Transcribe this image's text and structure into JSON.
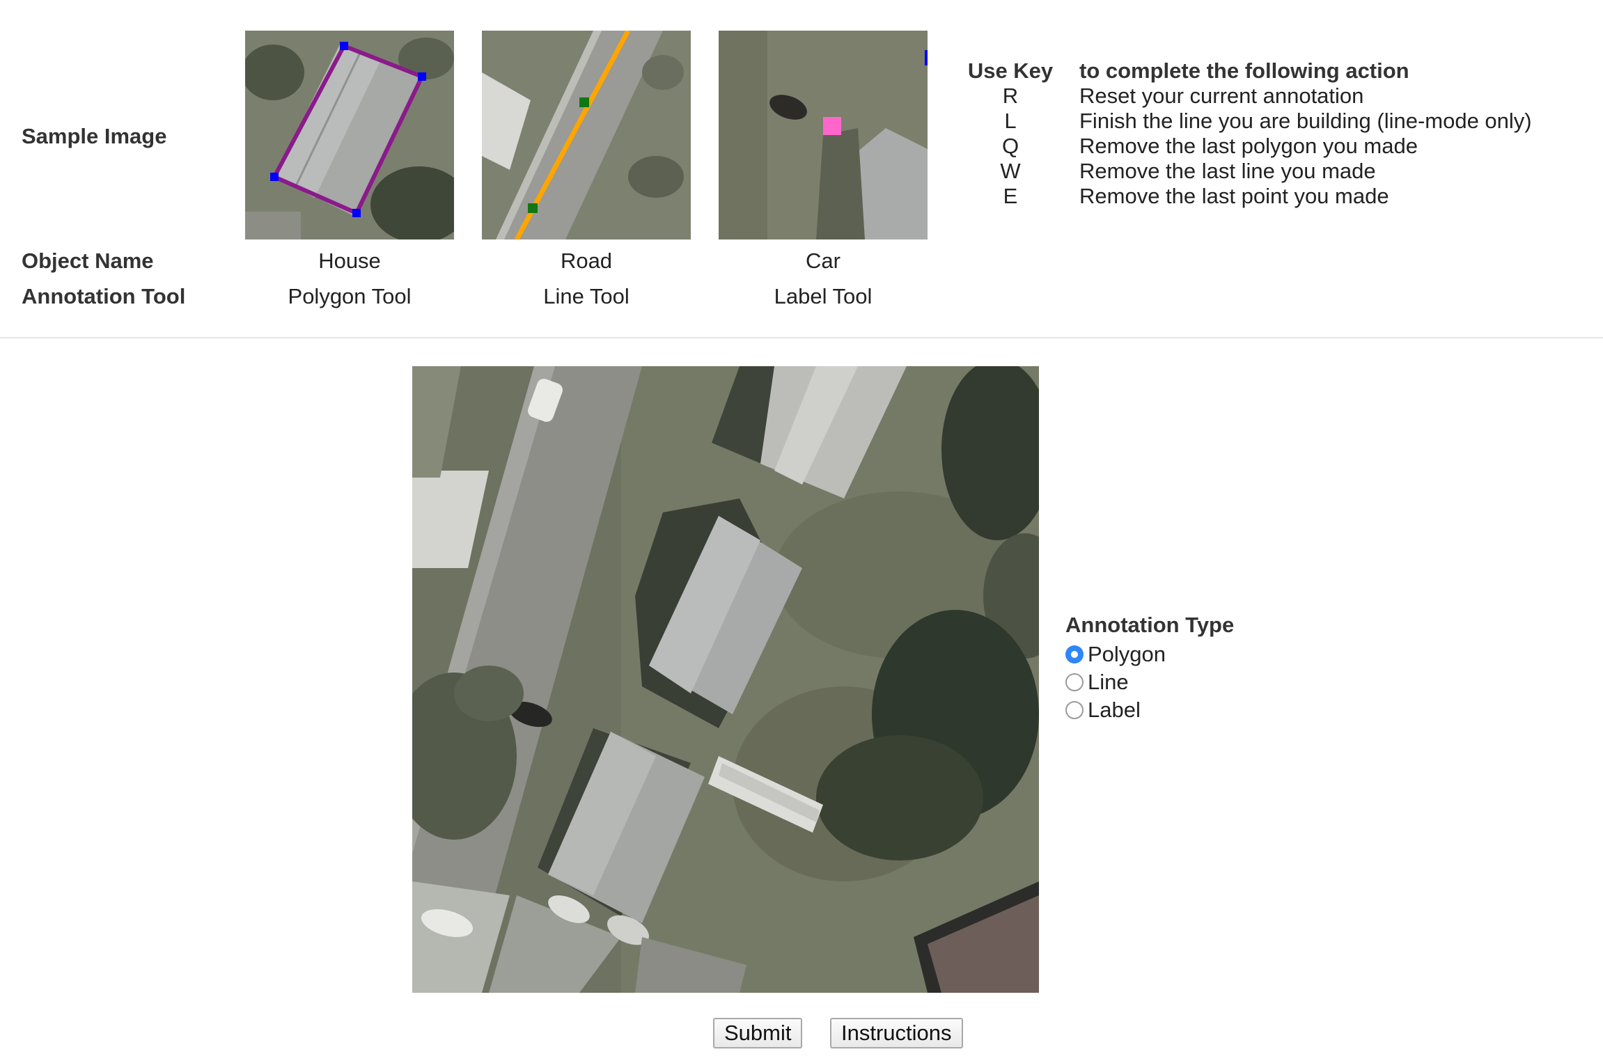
{
  "samples": {
    "row_labels": {
      "sample_image": "Sample Image",
      "object_name": "Object Name",
      "annotation_tool": "Annotation Tool"
    },
    "columns": [
      {
        "object": "House",
        "tool": "Polygon Tool",
        "overlay": "purple-polygon"
      },
      {
        "object": "Road",
        "tool": "Line Tool",
        "overlay": "orange-line"
      },
      {
        "object": "Car",
        "tool": "Label Tool",
        "overlay": "pink-label-marker"
      }
    ]
  },
  "keys": {
    "header_key": "Use Key",
    "header_action": "to complete the following action",
    "rows": [
      {
        "key": "R",
        "action": "Reset your current annotation"
      },
      {
        "key": "L",
        "action": "Finish the line you are building (line-mode only)"
      },
      {
        "key": "Q",
        "action": "Remove the last polygon you made"
      },
      {
        "key": "W",
        "action": "Remove the last line you made"
      },
      {
        "key": "E",
        "action": "Remove the last point you made"
      }
    ]
  },
  "annotation_type": {
    "title": "Annotation Type",
    "options": [
      {
        "label": "Polygon",
        "checked": true
      },
      {
        "label": "Line",
        "checked": false
      },
      {
        "label": "Label",
        "checked": false
      }
    ]
  },
  "buttons": {
    "submit": "Submit",
    "instructions": "Instructions"
  },
  "colors": {
    "polygon": "#8b1a8b",
    "line": "#ffa500",
    "label": "#ff66cc",
    "radio_selected": "#2f86f6"
  }
}
